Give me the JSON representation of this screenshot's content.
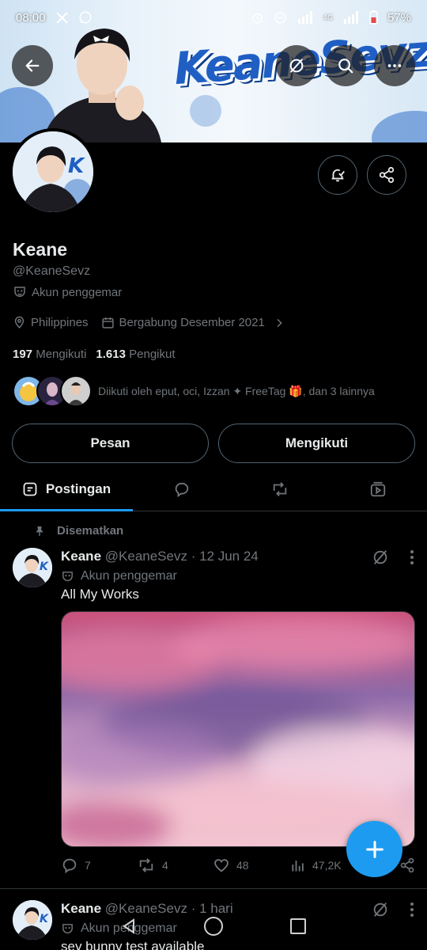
{
  "status_bar": {
    "time": "08:00",
    "network": "4G",
    "battery": "57%"
  },
  "banner": {
    "wordmark": "KeaneSevz"
  },
  "profile": {
    "name": "Keane",
    "handle": "@KeaneSevz",
    "label": "Akun penggemar",
    "location": "Philippines",
    "joined": "Bergabung Desember 2021",
    "following_count": "197",
    "following_label": "Mengikuti",
    "followers_count": "1.613",
    "followers_label": "Pengikut",
    "followed_by": "Diikuti oleh eput, oci, Izzan ✦ FreeTag 🎁, dan 3 lainnya"
  },
  "buttons": {
    "message": "Pesan",
    "following": "Mengikuti"
  },
  "tabs": {
    "posts": "Postingan"
  },
  "pinned_label": "Disematkan",
  "posts": [
    {
      "name": "Keane",
      "handle_time": "@KeaneSevz · 12 Jun 24",
      "label": "Akun penggemar",
      "text": "All My Works",
      "replies": "7",
      "reposts": "4",
      "likes": "48",
      "views": "47,2K"
    },
    {
      "name": "Keane",
      "handle_time": "@KeaneSevz · 1 hari",
      "label": "Akun penggemar",
      "text": "sey bunny test available"
    }
  ],
  "colors": {
    "accent": "#1d9bf0",
    "background": "#000000",
    "secondary_text": "#71767b"
  }
}
